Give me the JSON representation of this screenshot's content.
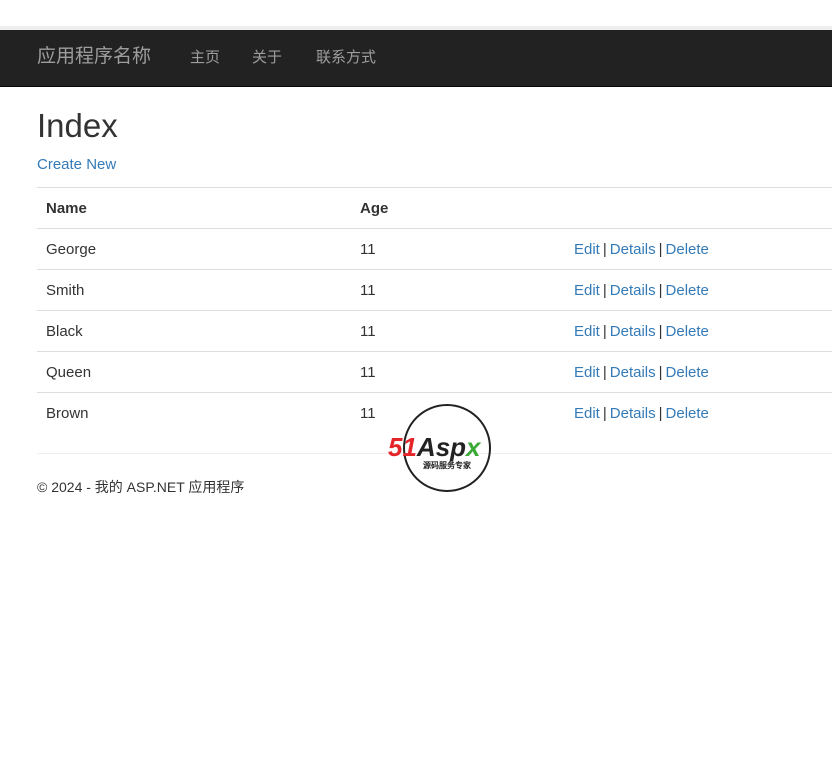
{
  "navbar": {
    "brand": "应用程序名称",
    "links": [
      "主页",
      "关于",
      "联系方式"
    ]
  },
  "main": {
    "title": "Index",
    "create_new": "Create New"
  },
  "table": {
    "headers": [
      "Name",
      "Age"
    ],
    "actions": [
      "Edit",
      "Details",
      "Delete"
    ],
    "separator": "|",
    "rows": [
      {
        "name": "George",
        "age": "11"
      },
      {
        "name": "Smith",
        "age": "11"
      },
      {
        "name": "Black",
        "age": "11"
      },
      {
        "name": "Queen",
        "age": "11"
      },
      {
        "name": "Brown",
        "age": "11"
      }
    ]
  },
  "footer": {
    "text": "© 2024 - 我的 ASP.NET 应用程序"
  },
  "watermark": {
    "logo_text": "51Aspx",
    "tagline": "源码服务专家"
  },
  "colors": {
    "navbar_bg": "#222222",
    "nav_text": "#9d9d9d",
    "link": "#337ab7",
    "watermark_red": "#e4262b",
    "watermark_green": "#3aa935"
  }
}
